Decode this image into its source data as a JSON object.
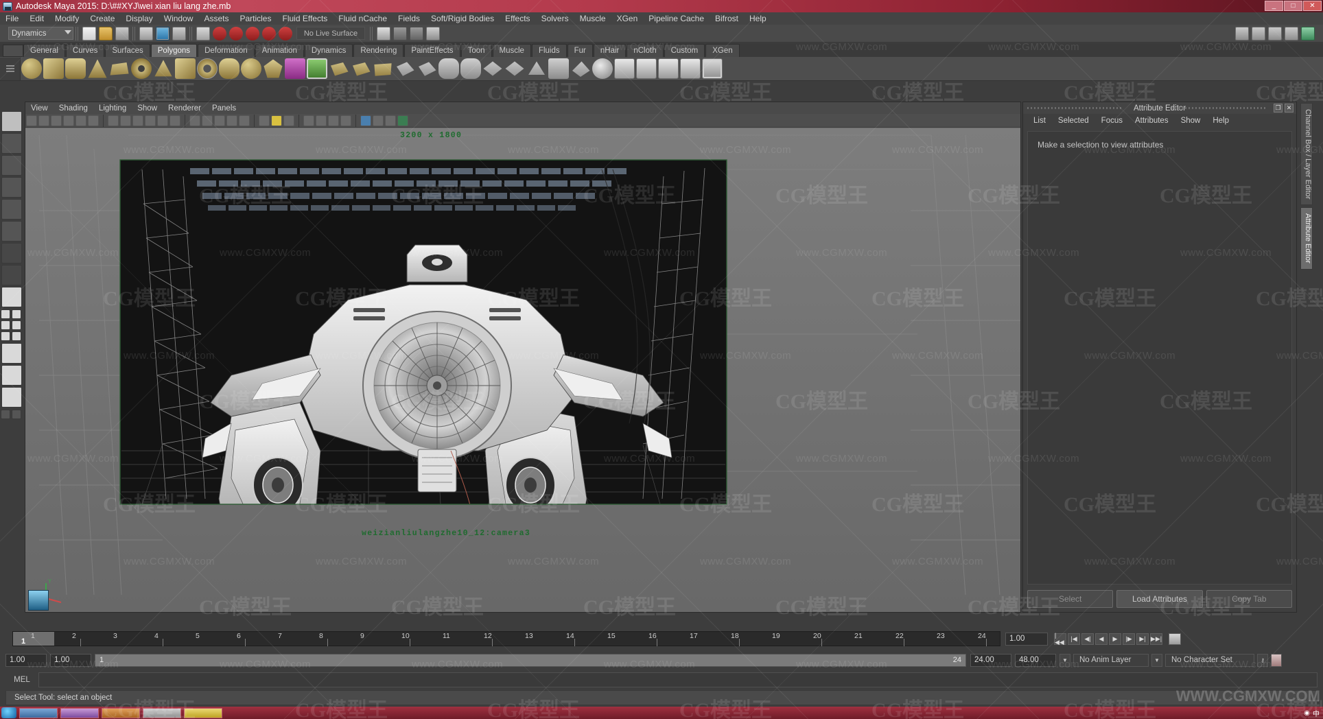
{
  "window": {
    "title": "Autodesk Maya 2015: D:\\##XYJ\\wei xian liu lang zhe.mb",
    "minimize": "_",
    "maximize": "□",
    "close": "✕"
  },
  "menubar": {
    "items": [
      "File",
      "Edit",
      "Modify",
      "Create",
      "Display",
      "Window",
      "Assets",
      "Particles",
      "Fluid Effects",
      "Fluid nCache",
      "Fields",
      "Soft/Rigid Bodies",
      "Effects",
      "Solvers",
      "Muscle",
      "XGen",
      "Pipeline Cache",
      "Bifrost",
      "Help"
    ]
  },
  "statusline": {
    "menu_set": "Dynamics",
    "live_surface": "No Live Surface"
  },
  "shelf": {
    "tabs": [
      "General",
      "Curves",
      "Surfaces",
      "Polygons",
      "Deformation",
      "Animation",
      "Dynamics",
      "Rendering",
      "PaintEffects",
      "Toon",
      "Muscle",
      "Fluids",
      "Fur",
      "nHair",
      "nCloth",
      "Custom",
      "XGen"
    ],
    "active_tab": "Polygons"
  },
  "viewport": {
    "menus": [
      "View",
      "Shading",
      "Lighting",
      "Show",
      "Renderer",
      "Panels"
    ],
    "resolution_label": "3200 x 1800",
    "camera_label": "weizianliulangzhe10_12:camera3",
    "axis_label": "Y"
  },
  "attribute_editor": {
    "title": "Attribute Editor",
    "menus": [
      "List",
      "Selected",
      "Focus",
      "Attributes",
      "Show",
      "Help"
    ],
    "message": "Make a selection to view attributes",
    "buttons": [
      "Select",
      "Load Attributes",
      "Copy Tab"
    ],
    "restore_icon": "❐",
    "close_icon": "✕"
  },
  "right_tabs": {
    "items": [
      "Channel Box / Layer Editor",
      "Attribute Editor"
    ],
    "active": "Attribute Editor"
  },
  "timeline": {
    "ticks": [
      1,
      2,
      3,
      4,
      5,
      6,
      7,
      8,
      9,
      10,
      11,
      12,
      13,
      14,
      15,
      16,
      17,
      18,
      19,
      20,
      21,
      22,
      23,
      24
    ],
    "current_frame": "1",
    "current_time_field": "1.00",
    "playback_buttons": [
      "|◀◀",
      "|◀",
      "◀|",
      "◀",
      "▶",
      "▶|",
      "▶|",
      "▶▶|"
    ]
  },
  "range": {
    "start": "1.00",
    "end": "1.00",
    "range_start": "1",
    "range_end": "24",
    "playback_start": "24.00",
    "playback_end": "48.00",
    "anim_layer": "No Anim Layer",
    "character_set": "No Character Set"
  },
  "command_line": {
    "label": "MEL",
    "value": ""
  },
  "status_bar": {
    "message": "Select Tool: select an object"
  },
  "watermarks": {
    "site": "www.CGMXW.com",
    "brand": "CG模型王",
    "footer": "WWW.CGMXW.COM"
  },
  "colors": {
    "title_accent": "#b33a4c",
    "viewport_gate": "#2f5d36",
    "green_text": "#1e6b2e",
    "panel_bg": "#3f3f3f"
  }
}
